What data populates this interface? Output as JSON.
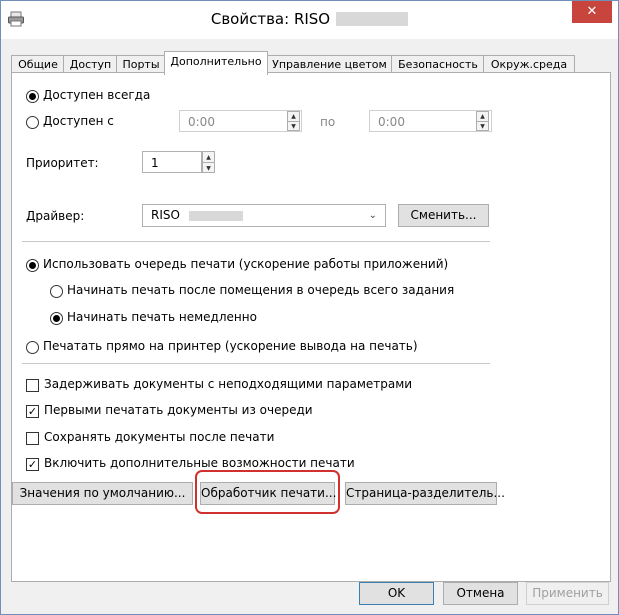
{
  "window": {
    "title": "Свойства: RISO",
    "close_label": "✕"
  },
  "tabs": [
    {
      "label": "Общие"
    },
    {
      "label": "Доступ"
    },
    {
      "label": "Порты"
    },
    {
      "label": "Дополнительно",
      "active": true
    },
    {
      "label": "Управление цветом"
    },
    {
      "label": "Безопасность"
    },
    {
      "label": "Окруж.среда"
    }
  ],
  "availability": {
    "always_label": "Доступен всегда",
    "from_label": "Доступен с",
    "from_time": "0:00",
    "to_label": "по",
    "to_time": "0:00",
    "selected": "always"
  },
  "priority": {
    "label": "Приоритет:",
    "value": "1"
  },
  "driver": {
    "label": "Драйвер:",
    "value": "RISO",
    "change_button": "Сменить..."
  },
  "spooling": {
    "use_spool_label": "Использовать очередь печати (ускорение работы приложений)",
    "start_after_last_page_label": "Начинать печать после помещения в очередь всего задания",
    "start_immediately_label": "Начинать печать немедленно",
    "direct_label": "Печатать прямо на принтер (ускорение вывода на печать)"
  },
  "options": [
    {
      "label": "Задерживать документы с неподходящими параметрами",
      "checked": false
    },
    {
      "label": "Первыми печатать документы из очереди",
      "checked": true
    },
    {
      "label": "Сохранять документы после печати",
      "checked": false
    },
    {
      "label": "Включить дополнительные возможности печати",
      "checked": true
    }
  ],
  "panel_buttons": {
    "defaults": "Значения по умолчанию...",
    "print_processor": "Обработчик печати...",
    "separator_page": "Страница-разделитель..."
  },
  "dialog_buttons": {
    "ok": "OK",
    "cancel": "Отмена",
    "apply": "Применить"
  },
  "colors": {
    "highlight": "#d0312d",
    "close": "#c7453d"
  }
}
